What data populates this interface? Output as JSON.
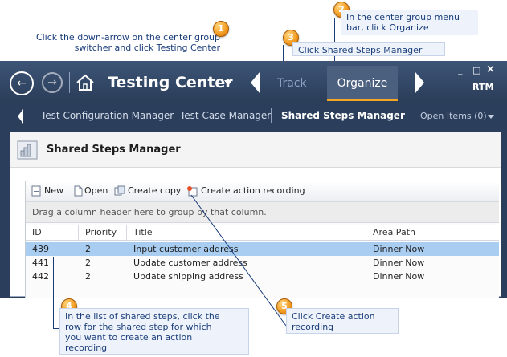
{
  "callouts": {
    "c1": {
      "num": "1",
      "line1": "Click the down-arrow on the center group",
      "line2": "switcher and click Testing Center"
    },
    "c2": {
      "num": "2",
      "line1": "In the center group menu",
      "line2": "bar, click Organize"
    },
    "c3": {
      "num": "3",
      "text": "Click Shared Steps Manager"
    },
    "c4": {
      "num": "4",
      "line1": "In the list of shared steps, click the",
      "line2": "row for the shared step for which",
      "line3": "you want to create an action",
      "line4": "recording"
    },
    "c5": {
      "num": "5",
      "line1": "Click Create action",
      "line2": "recording"
    }
  },
  "titlebar": {
    "center_title": "Testing Center",
    "tab_track": "Track",
    "tab_organize": "Organize",
    "rtm": "RTM",
    "min": "_",
    "max": "□",
    "close": "×",
    "back_glyph": "←",
    "forward_glyph": "→"
  },
  "subnav": {
    "items": [
      "Test Configuration Manager",
      "Test Case Manager",
      "Shared Steps Manager"
    ],
    "open_items": "Open Items (0)"
  },
  "pane": {
    "title": "Shared Steps Manager",
    "toolbar": {
      "new": "New",
      "open": "Open",
      "create_copy": "Create copy",
      "create_action_recording": "Create action recording"
    },
    "group_hint": "Drag a column header here to group by that column.",
    "columns": [
      "ID",
      "Priority",
      "Title",
      "Area Path"
    ],
    "rows": [
      {
        "id": "439",
        "priority": "2",
        "title": "Input customer address",
        "area": "Dinner Now",
        "selected": true
      },
      {
        "id": "441",
        "priority": "2",
        "title": "Update customer address",
        "area": "Dinner Now",
        "selected": false
      },
      {
        "id": "442",
        "priority": "2",
        "title": "Update shipping address",
        "area": "Dinner Now",
        "selected": false
      }
    ]
  },
  "colors": {
    "accent": "#f5a623",
    "titlebar": "#2b3f5c",
    "selected_row": "#a9cdf0",
    "callout_text": "#1a3d7a"
  }
}
